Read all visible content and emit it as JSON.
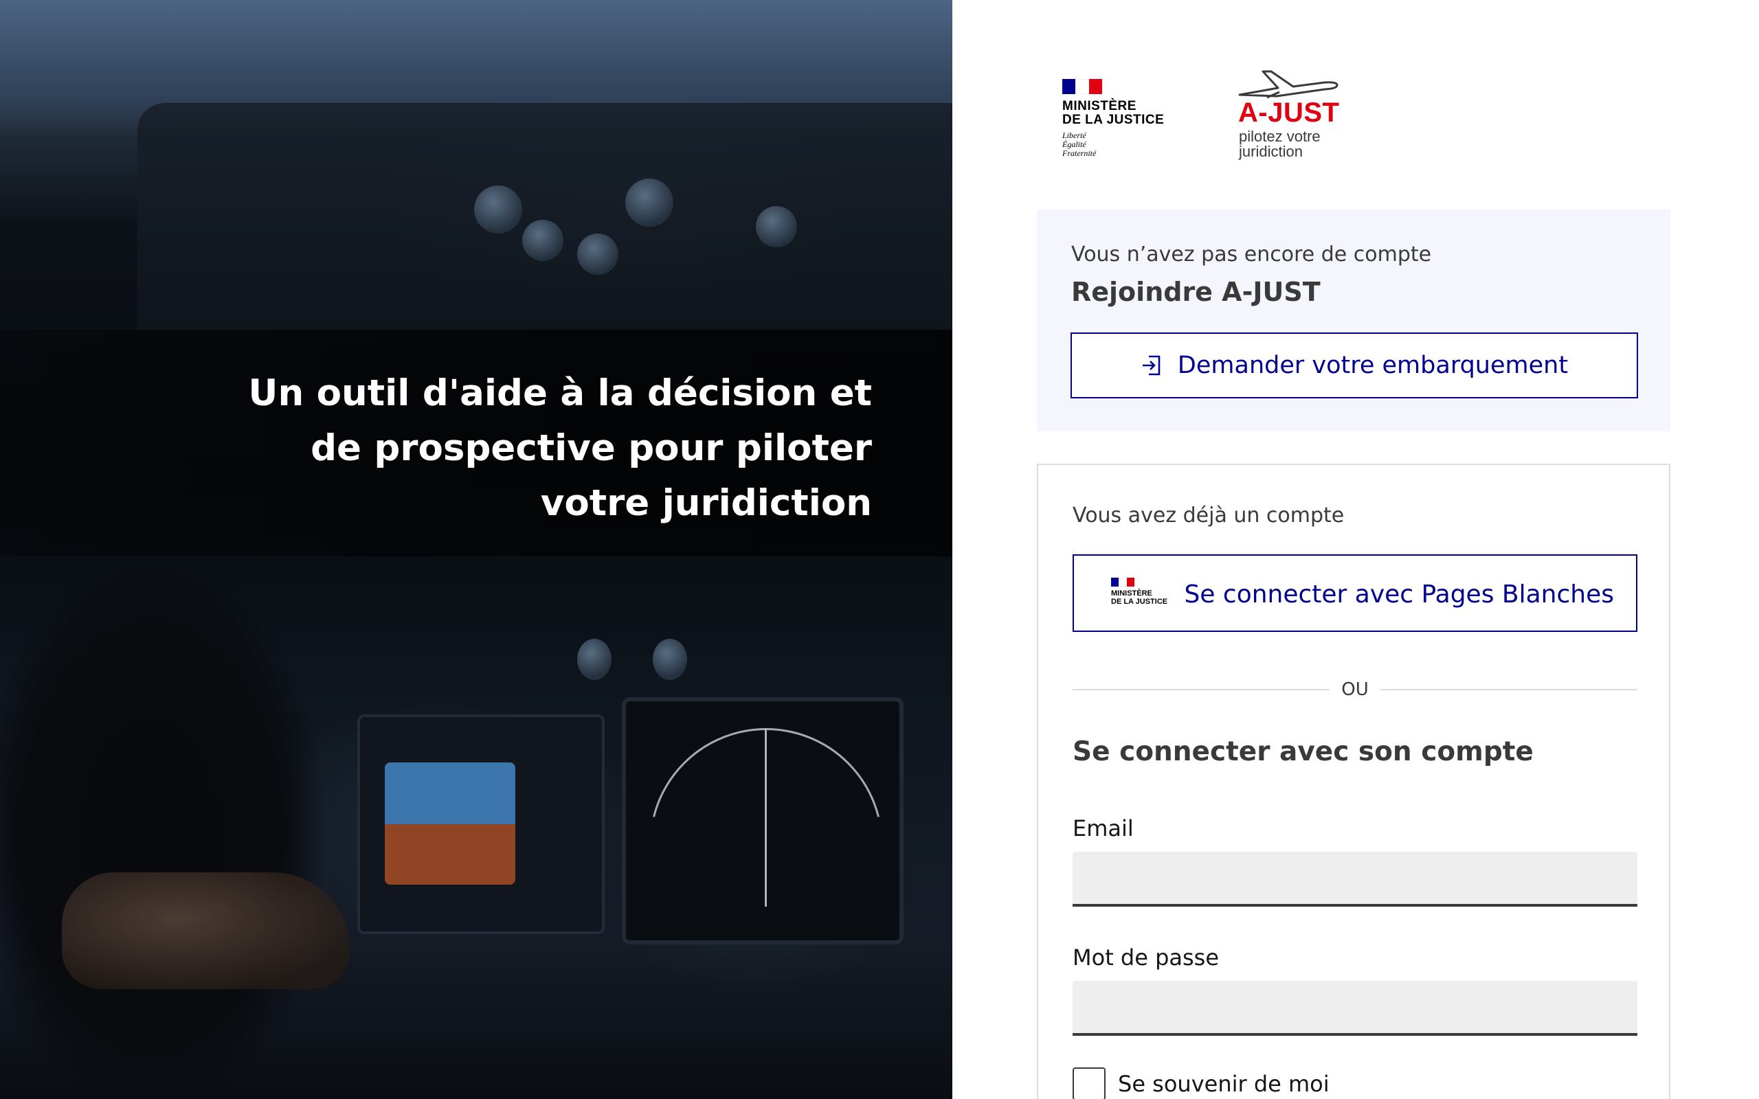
{
  "hero": {
    "title": "Un outil d'aide à la décision et\nde prospective pour piloter\nvotre juridiction"
  },
  "logos": {
    "ministere_name": "MINISTÈRE\nDE LA JUSTICE",
    "devise": "Liberté\nÉgalité\nFraternité",
    "app_name": "A-JUST",
    "app_tagline": "pilotez votre\njuridiction"
  },
  "join": {
    "subtitle": "Vous n’avez pas encore de compte",
    "title": "Rejoindre A-JUST",
    "button_label": "Demander votre embarquement",
    "button_icon": "login-icon"
  },
  "login": {
    "have_account": "Vous avez déjà un compte",
    "sso": {
      "logo_text": "MINISTÈRE\nDE LA JUSTICE",
      "label": "Se connecter avec Pages Blanches"
    },
    "separator": "OU",
    "form_title": "Se connecter avec son compte",
    "email_label": "Email",
    "email_value": "",
    "password_label": "Mot de passe",
    "password_value": "",
    "remember_label": "Se souvenir de moi",
    "remember_checked": false
  },
  "colors": {
    "primary_blue": "#000091",
    "marianne_red": "#e1000f",
    "card_bg": "#f5f5fe",
    "input_bg": "#eeeeee"
  }
}
